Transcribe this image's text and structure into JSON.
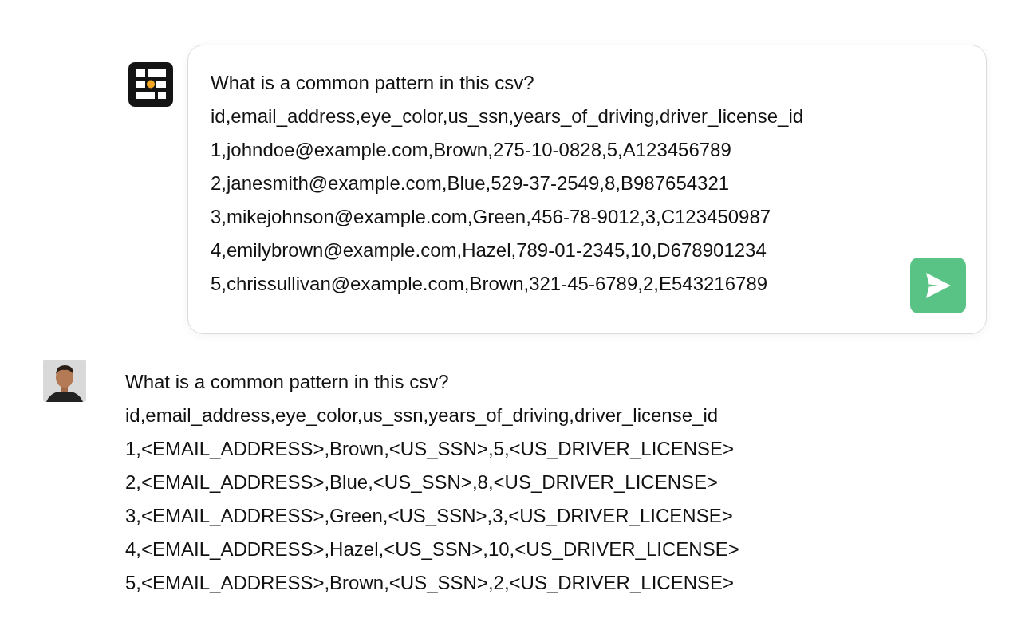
{
  "prompt": {
    "lines": [
      "What is a common pattern in this csv?",
      "id,email_address,eye_color,us_ssn,years_of_driving,driver_license_id",
      "1,johndoe@example.com,Brown,275-10-0828,5,A123456789",
      "2,janesmith@example.com,Blue,529-37-2549,8,B987654321",
      "3,mikejohnson@example.com,Green,456-78-9012,3,C123450987",
      "4,emilybrown@example.com,Hazel,789-01-2345,10,D678901234",
      "5,chrissullivan@example.com,Brown,321-45-6789,2,E543216789"
    ]
  },
  "response": {
    "lines": [
      "What is a common pattern in this csv?",
      "id,email_address,eye_color,us_ssn,years_of_driving,driver_license_id",
      "1,<EMAIL_ADDRESS>,Brown,<US_SSN>,5,<US_DRIVER_LICENSE>",
      "2,<EMAIL_ADDRESS>,Blue,<US_SSN>,8,<US_DRIVER_LICENSE>",
      "3,<EMAIL_ADDRESS>,Green,<US_SSN>,3,<US_DRIVER_LICENSE>",
      "4,<EMAIL_ADDRESS>,Hazel,<US_SSN>,10,<US_DRIVER_LICENSE>",
      "5,<EMAIL_ADDRESS>,Brown,<US_SSN>,2,<US_DRIVER_LICENSE>"
    ]
  }
}
